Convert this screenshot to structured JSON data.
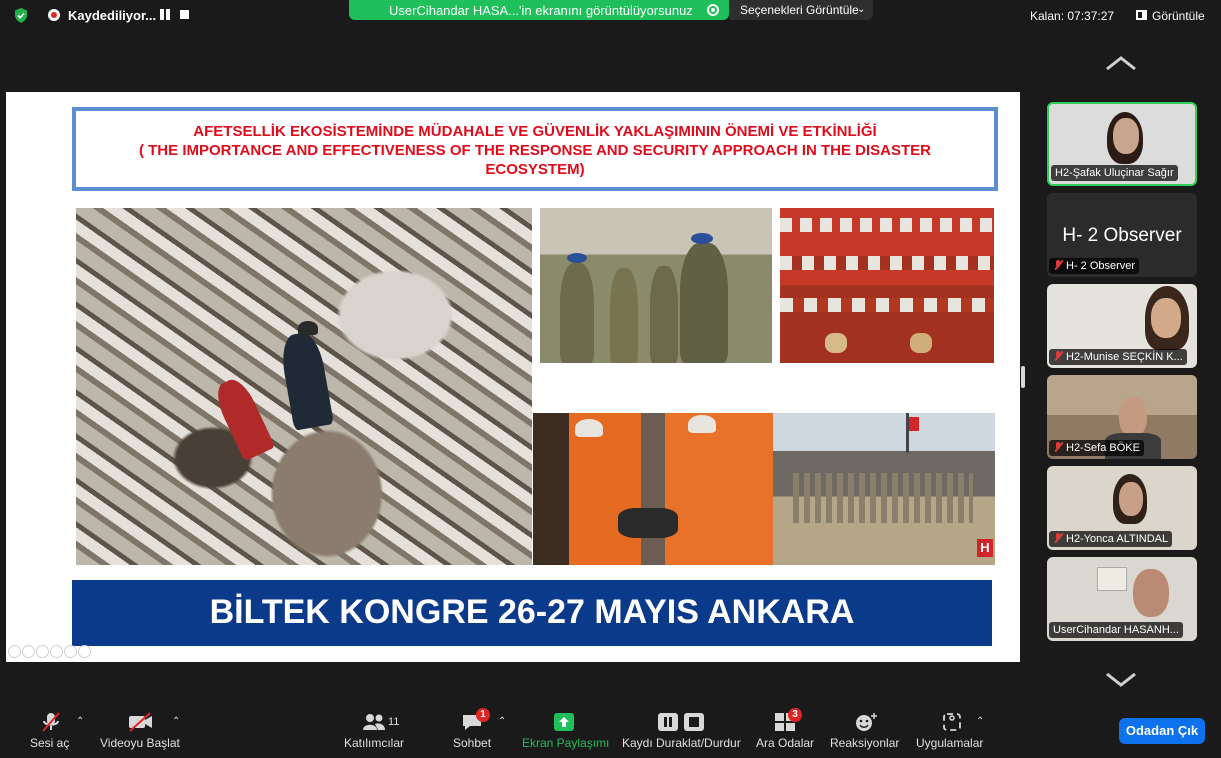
{
  "topbar": {
    "recording_label": "Kaydediliyor...",
    "share_message": "UserCihandar HASA...'in ekranını görüntülüyorsunuz",
    "view_options_label": "Seçenekleri Görüntüle",
    "timer": "Kalan: 07:37:27",
    "view_label": "Görüntüle",
    "colors": {
      "share_green": "#1fbf5c",
      "record_red": "#e02424"
    }
  },
  "slide": {
    "title_line1": "AFETSELLİK EKOSİSTEMİNDE MÜDAHALE VE GÜVENLİK YAKLAŞIMININ ÖNEMİ VE ETKİNLİĞİ",
    "title_line2": "( THE IMPORTANCE AND EFFECTIVENESS OF THE RESPONSE AND SECURITY APPROACH IN THE DISASTER",
    "title_line3": "ECOSYSTEM)",
    "banner": "BİLTEK KONGRE 26-27 MAYIS ANKARA",
    "logo_letter": "H",
    "colors": {
      "title_red": "#e00c1c",
      "banner_blue": "#0c3a8a",
      "frame_blue": "#5c8fd0"
    }
  },
  "participants": [
    {
      "name": "H2-Şafak Uluçinar Sağır",
      "muted": false,
      "active": true,
      "skin": "#c9a58e",
      "bg": "#dcdcdc",
      "hair": "#2a1c14"
    },
    {
      "name": "H- 2 Observer",
      "big_name": "H- 2 Observer",
      "muted": true,
      "active": false
    },
    {
      "name": "H2-Munise SEÇKİN K...",
      "muted": true,
      "active": false,
      "skin": "#d3a98c",
      "bg": "#e4e2dc",
      "hair": "#3a261a"
    },
    {
      "name": "H2-Sefa BÖKE",
      "muted": true,
      "active": false,
      "skin": "#c49a80",
      "bg": "#8f7a64",
      "hair": "#4a4a4a"
    },
    {
      "name": "H2-Yonca ALTINDAL",
      "muted": true,
      "active": false,
      "skin": "#c8a088",
      "bg": "#dbd6cc",
      "hair": "#2f2118"
    },
    {
      "name": "UserCihandar HASANH...",
      "muted": false,
      "active": false,
      "skin": "#b98b74",
      "bg": "#d9d7cf",
      "hair": "#3a3a3a"
    }
  ],
  "toolbar": {
    "unmute": "Sesi aç",
    "start_video": "Videoyu Başlat",
    "participants": "Katılımcılar",
    "participant_count": "11",
    "chat": "Sohbet",
    "chat_badge": "1",
    "share_screen": "Ekran Paylaşımı",
    "pause_recording": "Kaydı Duraklat/Durdur",
    "breakout_rooms": "Ara Odalar",
    "breakout_badge": "3",
    "reactions": "Reaksiyonlar",
    "apps": "Uygulamalar",
    "leave": "Odadan Çık",
    "colors": {
      "leave_blue": "#0e72ed",
      "share_green": "#1fbf5c"
    }
  }
}
